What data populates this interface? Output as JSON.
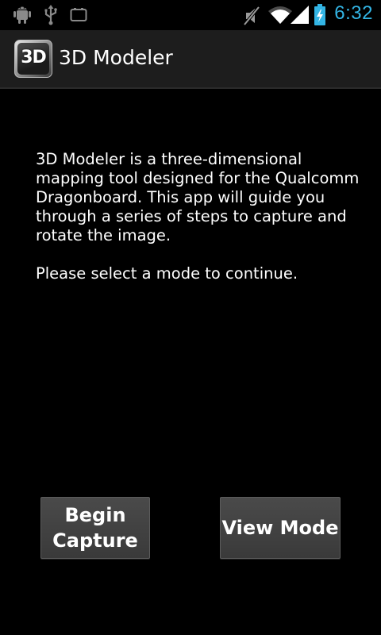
{
  "status_bar": {
    "time": "6:32",
    "accent_color": "#33b5e5",
    "icons": [
      "android-debug-icon",
      "usb-icon",
      "storage-icon",
      "mute-icon",
      "wifi-icon",
      "signal-icon",
      "battery-charging-icon"
    ]
  },
  "action_bar": {
    "app_icon_text": "3D",
    "title": "3D Modeler"
  },
  "main": {
    "description": "3D Modeler is a three-dimensional mapping tool designed for the Qualcomm Dragonboard. This app will guide you through a series of steps to capture and rotate the image.",
    "prompt": "Please select a mode to continue."
  },
  "buttons": {
    "begin_capture": "Begin Capture",
    "view_mode": "View Mode"
  }
}
